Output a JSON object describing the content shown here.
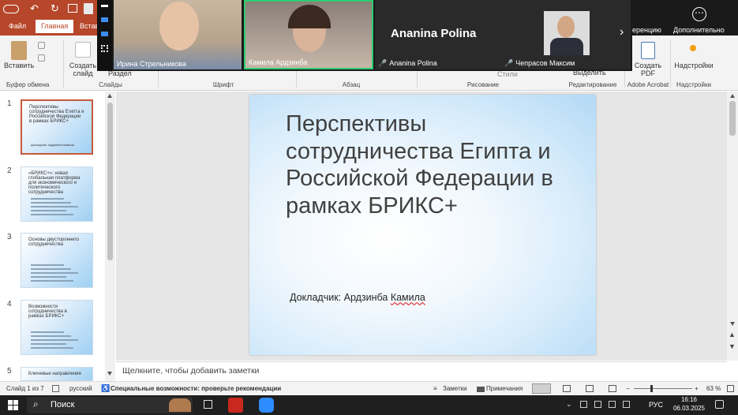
{
  "colors": {
    "ribbon_accent": "#b7472a",
    "selection": "#c55a3a",
    "zoom_active_border": "#2ecc71"
  },
  "tabs": {
    "file": "Файл",
    "home": "Главная",
    "insert": "Вставка"
  },
  "ribbon": {
    "paste": "Вставить",
    "clipboard": "Буфер обмена",
    "new_slide_1": "Создать",
    "new_slide_2": "слайд",
    "section": "Раздел",
    "slides": "Слайды",
    "font": "Шрифт",
    "paragraph": "Абзац",
    "styles": "Стили",
    "drawing": "Рисование",
    "select": "Выделить",
    "editing": "Редактирование",
    "acrobat": "Adobe Acrobat",
    "create_pdf_1": "Создать",
    "create_pdf_2": "PDF",
    "addins": "Надстройки",
    "addins_group": "Надстройки"
  },
  "zoom": {
    "participants": [
      "Ирина Стрельникова",
      "Камила Ардзинба",
      "Ananina Polina",
      "Чепрасов Максим"
    ],
    "big_name": "Ananina Polina",
    "conference": "еренцию",
    "more": "Дополнительно",
    "more_glyph": "⋯",
    "next": "›"
  },
  "thumbnails": [
    {
      "num": "1",
      "title": "Перспективы сотрудничества Египта и Российской Федерации в рамках БРИКС+",
      "sub": "Докладчик: Ардзинба Камила"
    },
    {
      "num": "2",
      "title": "«БРИКС+»: новая глобальная платформа для экономического и политического сотрудничества",
      "sub": ""
    },
    {
      "num": "3",
      "title": "Основы двустороннего сотрудничества",
      "sub": ""
    },
    {
      "num": "4",
      "title": "Возможности сотрудничества в рамках БРИКС+",
      "sub": ""
    },
    {
      "num": "5",
      "title": "Ключевые направления",
      "sub": ""
    }
  ],
  "slide": {
    "title": "Перспективы сотрудничества Египта и Российской Федерации в рамках БРИКС+",
    "reporter_label": "Докладчик: Ардзинба ",
    "reporter_name": "Камила"
  },
  "notes_placeholder": "Щелкните, чтобы добавить заметки",
  "status": {
    "slide": "Слайд 1 из 7",
    "lang": "русский",
    "accessibility": "Специальные возможности: проверьте рекомендации",
    "notes": "Заметки",
    "comments": "Примечания",
    "zoom": "63 %"
  },
  "taskbar": {
    "search": "Поиск",
    "lang": "РУС",
    "time": "16:16",
    "date": "06.03.2025"
  }
}
